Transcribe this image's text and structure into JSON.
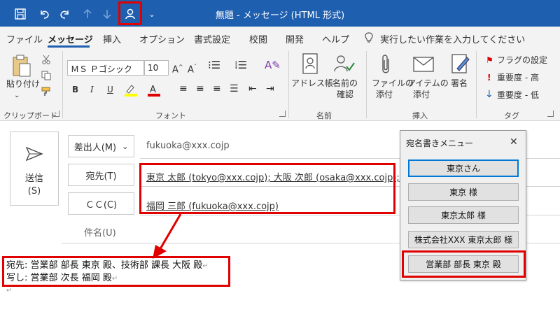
{
  "window": {
    "title": "無題 - メッセージ (HTML 形式)"
  },
  "quick_access": {
    "customize_label": "⌄"
  },
  "tabs": [
    {
      "label": "ファイル"
    },
    {
      "label": "メッセージ"
    },
    {
      "label": "挿入"
    },
    {
      "label": "オプション"
    },
    {
      "label": "書式設定"
    },
    {
      "label": "校閲"
    },
    {
      "label": "開発"
    },
    {
      "label": "ヘルプ"
    }
  ],
  "tell_me": {
    "placeholder": "実行したい作業を入力してください"
  },
  "ribbon": {
    "clipboard": {
      "paste_label": "貼り付け",
      "group_label": "クリップボード"
    },
    "font": {
      "font_name": "ＭＳ Ｐゴシック",
      "font_size": "10",
      "group_label": "フォント",
      "bold": "B",
      "italic": "I",
      "underline": "U"
    },
    "names": {
      "address_book": "アドレス帳",
      "check_names_1": "名前の",
      "check_names_2": "確認",
      "group_label": "名前"
    },
    "insert": {
      "attach_file_1": "ファイルの",
      "attach_file_2": "添付",
      "attach_item_1": "アイテムの",
      "attach_item_2": "添付",
      "signature": "署名",
      "group_label": "挿入"
    },
    "tags": {
      "follow_up": "フラグの設定",
      "high_importance": "重要度 - 高",
      "low_importance": "重要度 - 低",
      "group_label": "タグ"
    }
  },
  "compose": {
    "send_label_1": "送信",
    "send_label_2": "(S)",
    "from_label": "差出人(M)",
    "from_value": "fukuoka@xxx.cojp",
    "to_label": "宛先(T)",
    "to_value": "東京 太郎 (tokyo@xxx.cojp); 大阪 次郎 (osaka@xxx.cojp);",
    "cc_label": "ＣＣ(C)",
    "cc_value": "福岡 三郎 (fukuoka@xxx.cojp)",
    "subject_label": "件名(U)"
  },
  "body": {
    "line1": "宛先: 営業部 部長 東京 殿、技術部 課長 大阪 殿",
    "line2": "写し: 営業部 次長 福岡 殿",
    "para_mark": "↵"
  },
  "popup": {
    "title": "宛名書きメニュー",
    "close": "✕",
    "buttons": [
      {
        "label": "東京さん"
      },
      {
        "label": "東京 様"
      },
      {
        "label": "東京太郎 様"
      },
      {
        "label": "株式会社XXX 東京太郎 様"
      },
      {
        "label": "営業部 部長 東京 殿"
      }
    ]
  },
  "colors": {
    "accent": "#1f5fb0",
    "highlight": "#e00000"
  }
}
